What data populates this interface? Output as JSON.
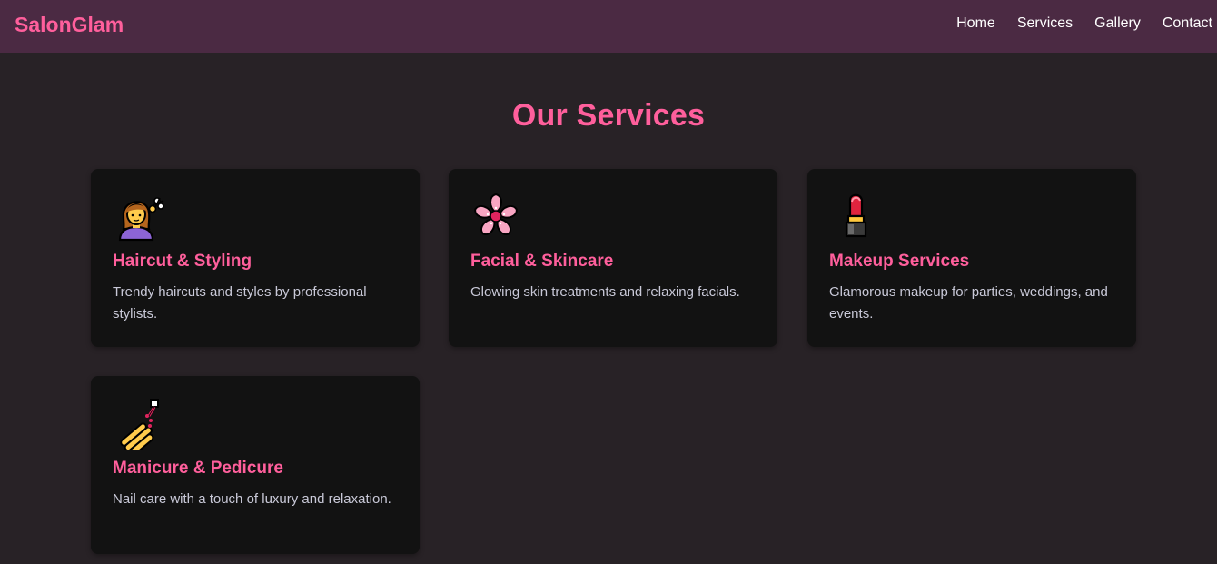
{
  "header": {
    "logo": "SalonGlam",
    "nav": [
      "Home",
      "Services",
      "Gallery",
      "Contact"
    ]
  },
  "services": {
    "title": "Our Services",
    "cards": [
      {
        "icon": "hairdresser-woman-icon",
        "title": "Haircut & Styling",
        "description": "Trendy haircuts and styles by professional stylists."
      },
      {
        "icon": "cherry-blossom-icon",
        "title": "Facial & Skincare",
        "description": "Glowing skin treatments and relaxing facials."
      },
      {
        "icon": "lipstick-icon",
        "title": "Makeup Services",
        "description": "Glamorous makeup for parties, weddings, and events."
      },
      {
        "icon": "nail-polish-icon",
        "title": "Manicure & Pedicure",
        "description": "Nail care with a touch of luxury and relaxation."
      }
    ]
  },
  "colors": {
    "accent": "#ff5f9c",
    "navbar": "#4b2a43",
    "background": "#282226",
    "card": "#121212"
  }
}
